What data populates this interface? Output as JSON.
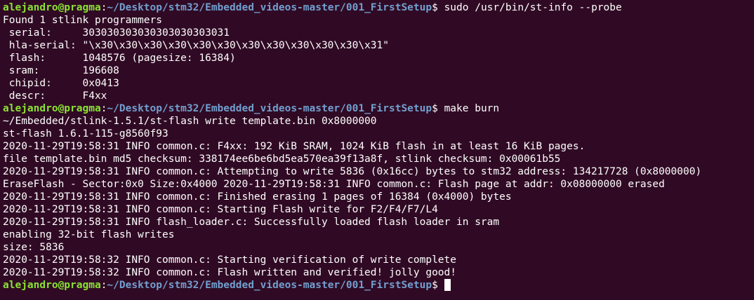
{
  "colors": {
    "background": "#300a24",
    "text": "#ffffff",
    "user_host": "#8ae234",
    "path": "#729fcf"
  },
  "prompt": {
    "user_host": "alejandro@pragma",
    "separator": ":",
    "path": "~/Desktop/stm32/Embedded_videos-master/001_FirstSetup",
    "symbol": "$ "
  },
  "commands": {
    "probe": "sudo /usr/bin/st-info --probe",
    "burn": "make burn",
    "current": ""
  },
  "probe_output": [
    "Found 1 stlink programmers",
    " serial:     303030303030303030303031",
    " hla-serial: \"\\x30\\x30\\x30\\x30\\x30\\x30\\x30\\x30\\x30\\x30\\x30\\x31\"",
    " flash:      1048576 (pagesize: 16384)",
    " sram:       196608",
    " chipid:     0x0413",
    " descr:      F4xx"
  ],
  "burn_output": [
    "~/Embedded/stlink-1.5.1/st-flash write template.bin 0x8000000",
    "st-flash 1.6.1-115-g8560f93",
    "2020-11-29T19:58:31 INFO common.c: F4xx: 192 KiB SRAM, 1024 KiB flash in at least 16 KiB pages.",
    "file template.bin md5 checksum: 338174ee6be6bd5ea570ea39f13a8f, stlink checksum: 0x00061b55",
    "2020-11-29T19:58:31 INFO common.c: Attempting to write 5836 (0x16cc) bytes to stm32 address: 134217728 (0x8000000)",
    "EraseFlash - Sector:0x0 Size:0x4000 2020-11-29T19:58:31 INFO common.c: Flash page at addr: 0x08000000 erased",
    "2020-11-29T19:58:31 INFO common.c: Finished erasing 1 pages of 16384 (0x4000) bytes",
    "2020-11-29T19:58:31 INFO common.c: Starting Flash write for F2/F4/F7/L4",
    "2020-11-29T19:58:31 INFO flash_loader.c: Successfully loaded flash loader in sram",
    "enabling 32-bit flash writes",
    "size: 5836",
    "2020-11-29T19:58:32 INFO common.c: Starting verification of write complete",
    "2020-11-29T19:58:32 INFO common.c: Flash written and verified! jolly good!"
  ]
}
